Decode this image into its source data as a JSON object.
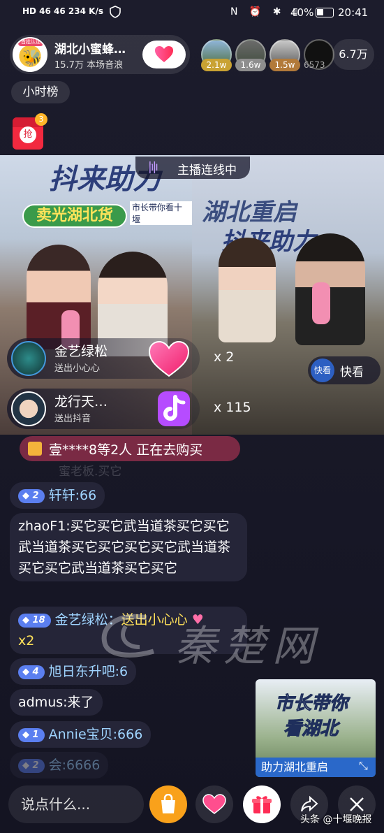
{
  "status_bar": {
    "left": "HD 46 46 234 K/s",
    "time": "20:41",
    "battery": "40%"
  },
  "host": {
    "name": "湖北小蜜蜂…",
    "stats": "15.7万 本场音浪",
    "avatar_badge": "首批认证"
  },
  "viewers": [
    {
      "badge": "2.1w"
    },
    {
      "badge": "1.6w"
    },
    {
      "badge": "1.5w"
    },
    {
      "badge": "6573"
    }
  ],
  "viewer_count": "6.7万",
  "hour_rank": "小时榜",
  "red_packet": {
    "label": "抢",
    "count": "3"
  },
  "pk_banner": "主播连线中",
  "stream_left": {
    "title_line": "抖来助力",
    "banner": "卖光湖北货",
    "sub": "市长带你看十堰"
  },
  "stream_right": {
    "title1": "湖北重启",
    "title2": "抖来助力",
    "follow_label": "快看",
    "follow_btn": "快看"
  },
  "gift_notices": [
    {
      "user": "金艺绿松",
      "action": "送出小心心",
      "count": "x 2",
      "gift_icon": "heart-gift-icon"
    },
    {
      "user": "龙行天…",
      "action": "送出抖音",
      "count": "x 115",
      "gift_icon": "douyin-gift-icon"
    }
  ],
  "purchase_notice": "壹****8等2人 正在去购买",
  "faded_line": "蜜老板.买它",
  "chat_messages": [
    {
      "level": "2",
      "text": "轩轩:66"
    },
    {
      "level": "",
      "text": "zhaoF1:买它买它武当道茶买它买它武当道茶买它买它买它买它武当道茶买它买它武当道茶买它买它"
    },
    {
      "level": "18",
      "user": "金艺绿松：",
      "gift": "送出小心心",
      "count": "x2"
    },
    {
      "level": "4",
      "text": "旭日东升吧:6"
    },
    {
      "level": "",
      "text": "admus:来了"
    },
    {
      "level": "1",
      "text": "Annie宝贝:666"
    },
    {
      "level": "2",
      "text": "会:6666"
    }
  ],
  "watermark": "秦楚网",
  "promo_card": {
    "title1": "市长带你",
    "title2": "看湖北",
    "caption": "助力湖北重启"
  },
  "input_placeholder": "说点什么...",
  "footer_credit": "头条 @十堰晚报",
  "colors": {
    "accent_pink": "#fe2c55",
    "chat_blue": "#9fd4ff",
    "gift_yellow": "#ffe15a",
    "level_blue": "#5b7ff0"
  }
}
